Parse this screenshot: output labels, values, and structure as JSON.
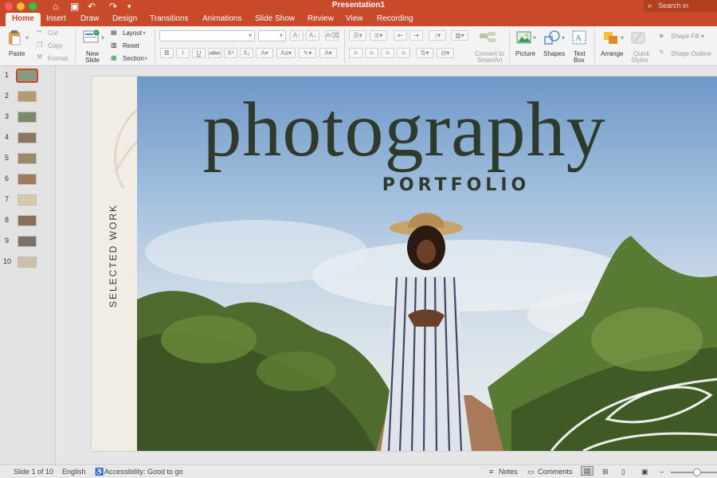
{
  "window": {
    "title": "Presentation1",
    "search_placeholder": "Search in Presentation"
  },
  "tabs": [
    "Home",
    "Insert",
    "Draw",
    "Design",
    "Transitions",
    "Animations",
    "Slide Show",
    "Review",
    "View",
    "Recording"
  ],
  "active_tab": "Home",
  "ribbon": {
    "paste": "Paste",
    "cut": "Cut",
    "copy": "Copy",
    "format": "Format",
    "new_slide_line1": "New",
    "new_slide_line2": "Slide",
    "layout": "Layout",
    "reset": "Reset",
    "section": "Section",
    "bold": "B",
    "italic": "I",
    "underline": "U",
    "strike": "abc",
    "superscript": "X²",
    "subscript": "X₂",
    "convert_line1": "Convert to",
    "convert_line2": "SmartArt",
    "picture": "Picture",
    "shapes": "Shapes",
    "textbox_line1": "Text",
    "textbox_line2": "Box",
    "arrange": "Arrange",
    "quick_styles_line1": "Quick",
    "quick_styles_line2": "Styles",
    "shape_fill": "Shape Fill",
    "shape_outline": "Shape Outline"
  },
  "slides": [
    {
      "num": "1",
      "color": "#8a9a7e"
    },
    {
      "num": "2",
      "color": "#b89a70"
    },
    {
      "num": "3",
      "color": "#7c8a6c"
    },
    {
      "num": "4",
      "color": "#8e7560"
    },
    {
      "num": "5",
      "color": "#9a8a6a"
    },
    {
      "num": "6",
      "color": "#a07a5a"
    },
    {
      "num": "7",
      "color": "#d8c8a8"
    },
    {
      "num": "8",
      "color": "#8a6e58"
    },
    {
      "num": "9",
      "color": "#7d7064"
    },
    {
      "num": "10",
      "color": "#cdbfa8"
    }
  ],
  "selected_slide": "1",
  "slide": {
    "headline": "photography",
    "subheadline": "PORTFOLIO",
    "side_text": "SELECTED WORK"
  },
  "status": {
    "slide_counter": "Slide 1 of 10",
    "language": "English",
    "accessibility": "Accessibility: Good to go",
    "notes": "Notes",
    "comments": "Comments"
  },
  "colors": {
    "brand": "#c94a2a",
    "headline": "#2e3a2a"
  }
}
